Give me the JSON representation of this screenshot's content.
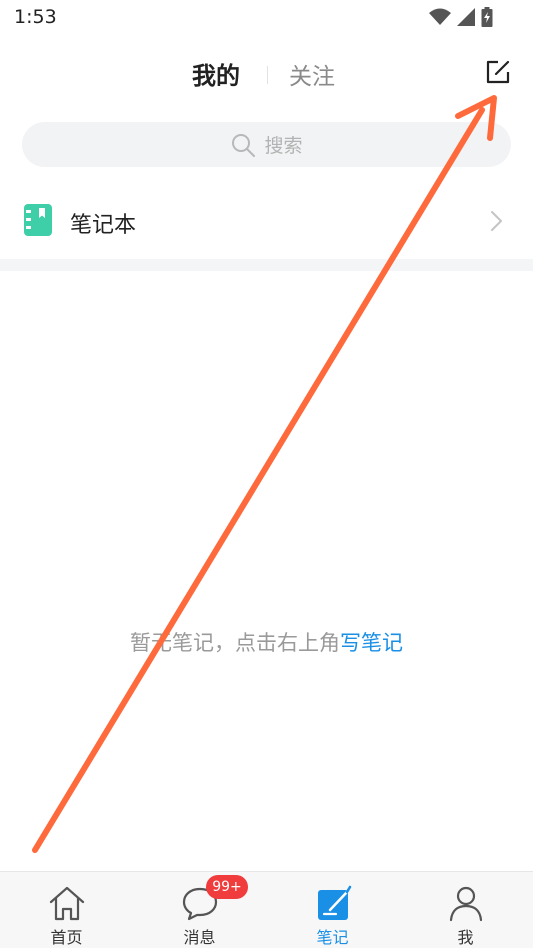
{
  "status_bar": {
    "time": "1:53"
  },
  "header": {
    "tab_mine": "我的",
    "tab_follow": "关注"
  },
  "search": {
    "placeholder": "搜索"
  },
  "notebook": {
    "label": "笔记本"
  },
  "empty_state": {
    "text": "暂无笔记，点击右上角",
    "link": "写笔记"
  },
  "tabbar": {
    "items": [
      {
        "label": "首页",
        "icon": "home-icon"
      },
      {
        "label": "消息",
        "icon": "chat-icon",
        "badge": "99+"
      },
      {
        "label": "笔记",
        "icon": "note-icon",
        "active": true
      },
      {
        "label": "我",
        "icon": "person-icon"
      }
    ]
  },
  "colors": {
    "accent": "#1a8fe6",
    "notebook_icon": "#3ecfa8",
    "badge": "#f03c3c",
    "annotation_arrow": "#ff6a3d"
  }
}
